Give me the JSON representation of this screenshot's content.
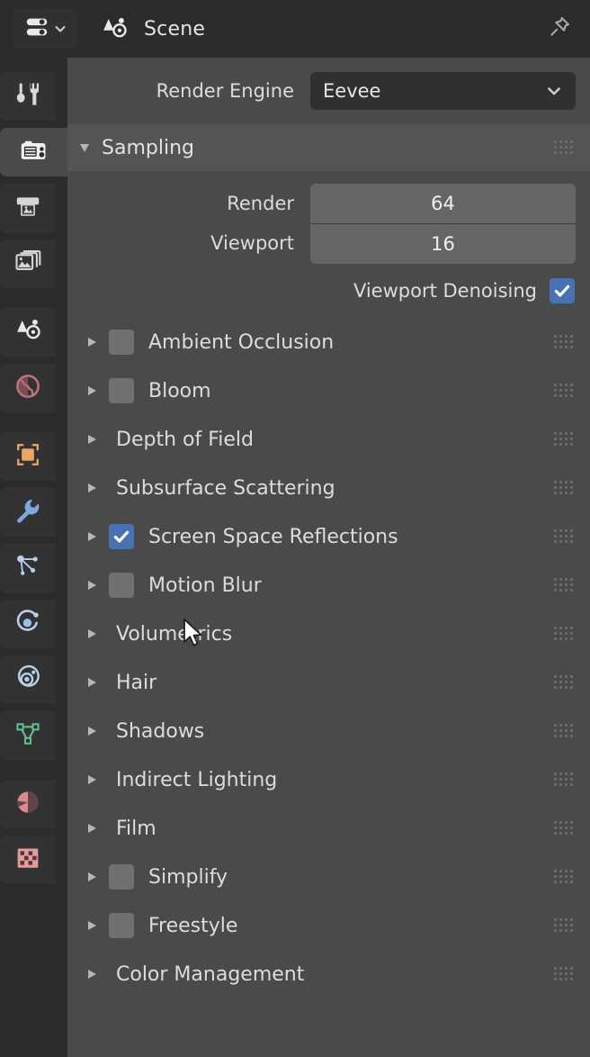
{
  "header": {
    "editor_type_icon": "properties-editor-icon",
    "editor_type_chevron": "chevron-down-icon",
    "datablock_icon": "scene-icon",
    "title": "Scene",
    "pin_icon": "pin-icon"
  },
  "tabs": [
    {
      "name": "tool",
      "icon": "tool-icon",
      "active": false
    },
    {
      "name": "render",
      "icon": "camera-back-icon",
      "active": true
    },
    {
      "name": "output",
      "icon": "printer-icon",
      "active": false
    },
    {
      "name": "view-layer",
      "icon": "image-stack-icon",
      "active": false
    },
    {
      "name": "scene",
      "icon": "scene-cone-sphere-icon",
      "active": false
    },
    {
      "name": "world",
      "icon": "world-globe-icon",
      "active": false
    },
    {
      "name": "object",
      "icon": "object-square-icon",
      "active": false
    },
    {
      "name": "modifiers",
      "icon": "wrench-icon",
      "active": false
    },
    {
      "name": "particles",
      "icon": "particles-icon",
      "active": false
    },
    {
      "name": "physics",
      "icon": "physics-orbit-icon",
      "active": false
    },
    {
      "name": "object-constraints",
      "icon": "constraint-icon",
      "active": false
    },
    {
      "name": "object-data",
      "icon": "mesh-data-icon",
      "active": false
    },
    {
      "name": "material",
      "icon": "material-sphere-icon",
      "active": false
    },
    {
      "name": "texture",
      "icon": "texture-checker-icon",
      "active": false
    }
  ],
  "render_engine": {
    "label": "Render Engine",
    "value": "Eevee",
    "chevron": "chevron-down-icon"
  },
  "sampling": {
    "title": "Sampling",
    "expanded": true,
    "disclosure_icon": "triangle-down-icon",
    "grip_icon": "drag-grip-icon",
    "fields": [
      {
        "label": "Render",
        "value": "64"
      },
      {
        "label": "Viewport",
        "value": "16"
      }
    ],
    "denoising": {
      "label": "Viewport Denoising",
      "checked": true,
      "checkbox_icon": "checkbox-checked-icon"
    }
  },
  "panels": [
    {
      "title": "Ambient Occlusion",
      "has_checkbox": true,
      "checked": false
    },
    {
      "title": "Bloom",
      "has_checkbox": true,
      "checked": false
    },
    {
      "title": "Depth of Field",
      "has_checkbox": false,
      "checked": false
    },
    {
      "title": "Subsurface Scattering",
      "has_checkbox": false,
      "checked": false
    },
    {
      "title": "Screen Space Reflections",
      "has_checkbox": true,
      "checked": true
    },
    {
      "title": "Motion Blur",
      "has_checkbox": true,
      "checked": false
    },
    {
      "title": "Volumetrics",
      "has_checkbox": false,
      "checked": false
    },
    {
      "title": "Hair",
      "has_checkbox": false,
      "checked": false
    },
    {
      "title": "Shadows",
      "has_checkbox": false,
      "checked": false
    },
    {
      "title": "Indirect Lighting",
      "has_checkbox": false,
      "checked": false
    },
    {
      "title": "Film",
      "has_checkbox": false,
      "checked": false
    },
    {
      "title": "Simplify",
      "has_checkbox": true,
      "checked": false
    },
    {
      "title": "Freestyle",
      "has_checkbox": true,
      "checked": false
    },
    {
      "title": "Color Management",
      "has_checkbox": false,
      "checked": false
    }
  ],
  "icons": {
    "collapsed_triangle": "triangle-right-icon",
    "grip": "drag-grip-icon",
    "cursor": "mouse-pointer-icon"
  },
  "colors": {
    "panel_bg": "#4a4a4a",
    "header_bg": "#2b2b2b",
    "subpanel_header_bg": "#545454",
    "field_bg": "#656565",
    "select_bg": "#303030",
    "checkbox_on": "#4772b3",
    "checkbox_off": "#707070",
    "text": "#dcdcdc"
  }
}
